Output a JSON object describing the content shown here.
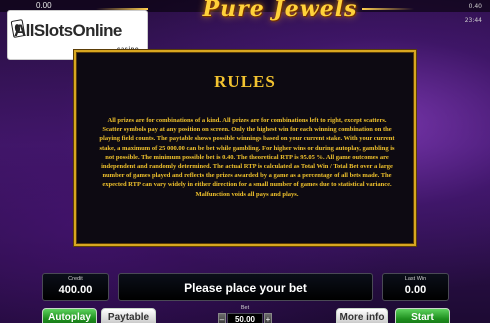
{
  "header": {
    "balance": "0.00",
    "stake": "0.40",
    "clock": "23:44",
    "logo": "Pure Jewels"
  },
  "watermark": {
    "text": "AllSlotsOnline",
    "sub": "casino"
  },
  "rules": {
    "title": "RULES",
    "body": "All prizes are for combinations of a kind. All prizes are for combinations left to right, except scatters. Scatter symbols pay at any position on screen. Only the highest win for each winning combination on the playing field counts. The paytable shows possible winnings based on your current stake. With your current stake, a maximum of 25 000.00 can be bet while gambling. For higher wins or during autoplay, gambling is not possible. The minimum possible bet is 0.40. The theoretical RTP is 95.05 %. All game outcomes are independent and randomly determined. The actual RTP is calculated as Total Win / Total Bet over a large number of games played and reflects the prizes awarded by a game as a percentage of all bets made. The expected RTP can vary widely in either direction for a small number of games due to statistical variance. Malfunction voids all pays and plays."
  },
  "console": {
    "credit_label": "Credit",
    "credit_value": "400.00",
    "message": "Please place your bet",
    "lastwin_label": "Last Win",
    "lastwin_value": "0.00",
    "bet_label": "Bet",
    "bet_value": "50.00"
  },
  "buttons": {
    "autoplay": "Autoplay",
    "paytable": "Paytable",
    "more_info": "More info",
    "start": "Start"
  },
  "colors": {
    "accent_gold": "#f2c330",
    "button_green": "#1e8f1e"
  }
}
